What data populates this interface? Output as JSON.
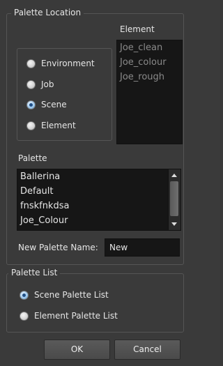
{
  "palette_location": {
    "title": "Palette Location",
    "element_header": "Element",
    "radios": [
      {
        "label": "Environment",
        "checked": false
      },
      {
        "label": "Job",
        "checked": false
      },
      {
        "label": "Scene",
        "checked": true
      },
      {
        "label": "Element",
        "checked": false
      }
    ],
    "element_list": [
      "Joe_clean",
      "Joe_colour",
      "Joe_rough"
    ],
    "palette_header": "Palette",
    "palette_list": [
      "Ballerina",
      "Default",
      "fnskfnkdsa",
      "Joe_Colour"
    ],
    "new_palette_label": "New Palette Name:",
    "new_palette_value": "New"
  },
  "palette_list_group": {
    "title": "Palette List",
    "radios": [
      {
        "label": "Scene Palette List",
        "checked": true
      },
      {
        "label": "Element Palette List",
        "checked": false
      }
    ]
  },
  "buttons": {
    "ok": "OK",
    "cancel": "Cancel"
  },
  "colors": {
    "background": "#3a3a3a",
    "list_background": "#161616",
    "accent": "#5c96c8"
  }
}
